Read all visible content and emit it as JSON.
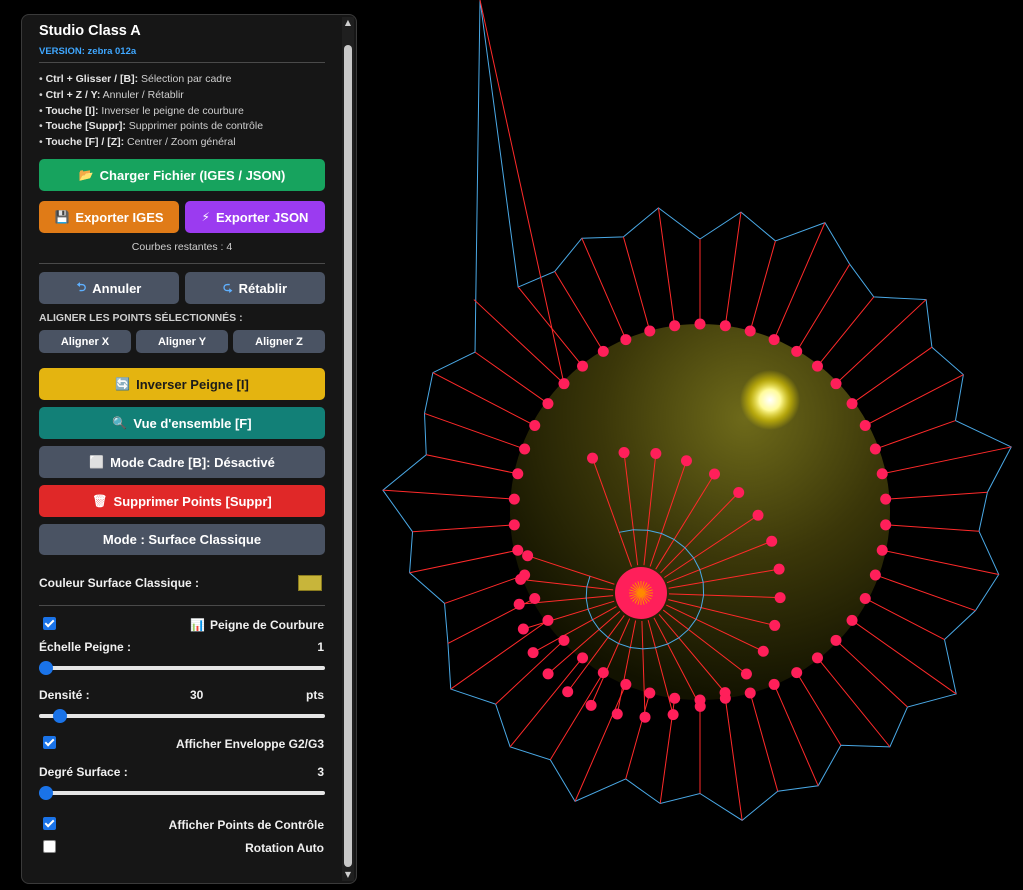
{
  "panel": {
    "title": "Studio Class A",
    "version": "VERSION: zebra 012a",
    "help": [
      {
        "keys": "Ctrl + Glisser / [B]:",
        "desc": " Sélection par cadre"
      },
      {
        "keys": "Ctrl + Z / Y:",
        "desc": " Annuler / Rétablir"
      },
      {
        "keys": "Touche [I]:",
        "desc": " Inverser le peigne de courbure"
      },
      {
        "keys": "Touche [Suppr]:",
        "desc": " Supprimer points de contrôle"
      },
      {
        "keys": "Touche [F] / [Z]:",
        "desc": " Centrer / Zoom général"
      }
    ],
    "load_button": {
      "label": "Charger Fichier (IGES / JSON)",
      "icon": "📂"
    },
    "export_iges_button": {
      "label": "Exporter IGES",
      "icon": "💾"
    },
    "export_json_button": {
      "label": "Exporter JSON",
      "icon": "⚡"
    },
    "curves_left": "Courbes restantes : 4",
    "undo_button": {
      "label": "Annuler",
      "icon": "⮌"
    },
    "redo_button": {
      "label": "Rétablir",
      "icon": "⮎"
    },
    "align_heading": "ALIGNER LES POINTS SÉLECTIONNÉS :",
    "align_x": "Aligner X",
    "align_y": "Aligner Y",
    "align_z": "Aligner Z",
    "invert_comb_button": {
      "label": "Inverser Peigne [I]",
      "icon": "🔄"
    },
    "overview_button": {
      "label": "Vue d'ensemble [F]",
      "icon": "🔍"
    },
    "frame_mode_button": {
      "label": "Mode Cadre [B]: Désactivé",
      "icon": "⬜"
    },
    "delete_points_button": {
      "label": "Supprimer Points [Suppr]",
      "icon": "🗑"
    },
    "surface_mode_button": "Mode : Surface Classique",
    "surface_color_label": "Couleur Surface Classique :",
    "surface_color": "#c8b53a",
    "comb_checkbox": {
      "label": "Peigne de Courbure",
      "icon": "📊",
      "checked": true
    },
    "comb_scale": {
      "label": "Échelle Peigne :",
      "value": "1",
      "fraction": 0.0
    },
    "density": {
      "label": "Densité :",
      "value": "30",
      "unit": "pts",
      "fraction": 0.05
    },
    "envelope_checkbox": {
      "label": "Afficher Enveloppe G2/G3",
      "checked": true
    },
    "surface_degree": {
      "label": "Degré Surface :",
      "value": "3",
      "fraction": 0.0
    },
    "control_points_checkbox": {
      "label": "Afficher Points de Contrôle",
      "checked": true
    },
    "auto_rotate_checkbox": {
      "label": "Rotation Auto",
      "checked": false
    }
  },
  "colors": {
    "green": "#17a35e",
    "orange": "#e07b17",
    "purple": "#9b3bf0",
    "gray": "#4a5363",
    "yellow": "#e4b410",
    "teal": "#128077",
    "red": "#e02828",
    "comb": "#ff2a2a",
    "envelope": "#4aa9e6",
    "control_point": "#ff1f5a"
  }
}
